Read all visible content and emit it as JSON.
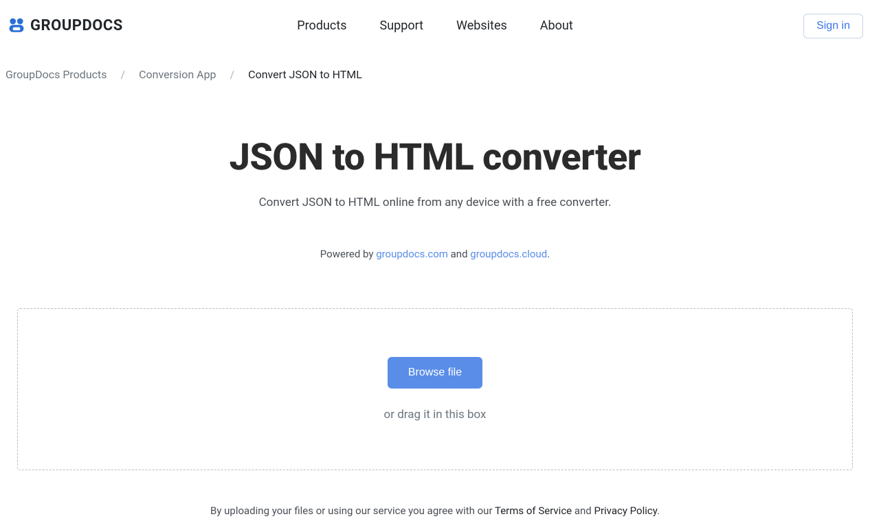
{
  "header": {
    "logo_text": "GROUPDOCS",
    "nav": [
      {
        "label": "Products"
      },
      {
        "label": "Support"
      },
      {
        "label": "Websites"
      },
      {
        "label": "About"
      }
    ],
    "signin_label": "Sign in"
  },
  "breadcrumb": {
    "items": [
      {
        "label": "GroupDocs Products",
        "current": false
      },
      {
        "label": "Conversion App",
        "current": false
      },
      {
        "label": "Convert JSON to HTML",
        "current": true
      }
    ],
    "separator": "/"
  },
  "hero": {
    "title": "JSON to HTML converter",
    "subtitle": "Convert JSON to HTML online from any device with a free converter.",
    "powered_prefix": "Powered by ",
    "powered_link1": "groupdocs.com",
    "powered_and": " and ",
    "powered_link2": "groupdocs.cloud",
    "powered_suffix": "."
  },
  "dropzone": {
    "browse_label": "Browse file",
    "drag_text": "or drag it in this box"
  },
  "agree": {
    "prefix": "By uploading your files or using our service you agree with our ",
    "terms": "Terms of Service",
    "and": " and ",
    "privacy": "Privacy Policy",
    "suffix": "."
  }
}
